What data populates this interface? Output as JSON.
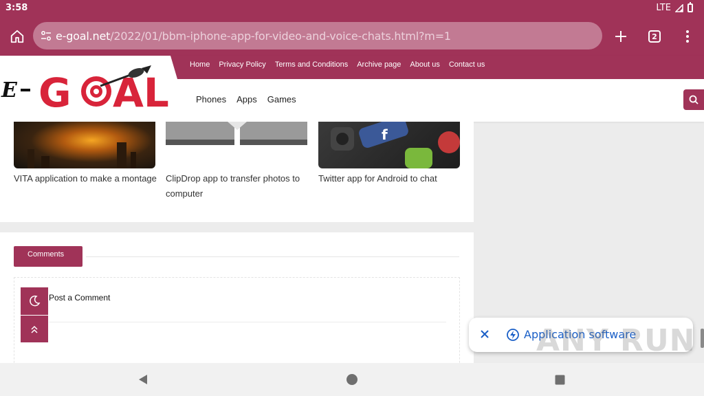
{
  "status_bar": {
    "time": "3:58",
    "network": "LTE"
  },
  "toolbar": {
    "url_host": "e-goal.net",
    "url_path": "/2022/01/bbm-iphone-app-for-video-and-voice-chats.html?m=1",
    "tab_count": "2"
  },
  "site": {
    "logo_text": "E-GOAL",
    "top_nav": [
      "Home",
      "Privacy Policy",
      "Terms and Conditions",
      "Archive page",
      "About us",
      "Contact us"
    ],
    "main_nav": [
      "Phones",
      "Apps",
      "Games"
    ]
  },
  "related": [
    {
      "title": "VITA application to make a montage"
    },
    {
      "title": "ClipDrop app to transfer photos to computer"
    },
    {
      "title": "Twitter app for Android to chat"
    }
  ],
  "comments": {
    "tab_label": "Comments",
    "post_label": "Post a Comment"
  },
  "toast": {
    "label": "Application software"
  },
  "watermark": "ANY RUN",
  "colors": {
    "brand": "#a03358",
    "link": "#1a5fc7"
  }
}
